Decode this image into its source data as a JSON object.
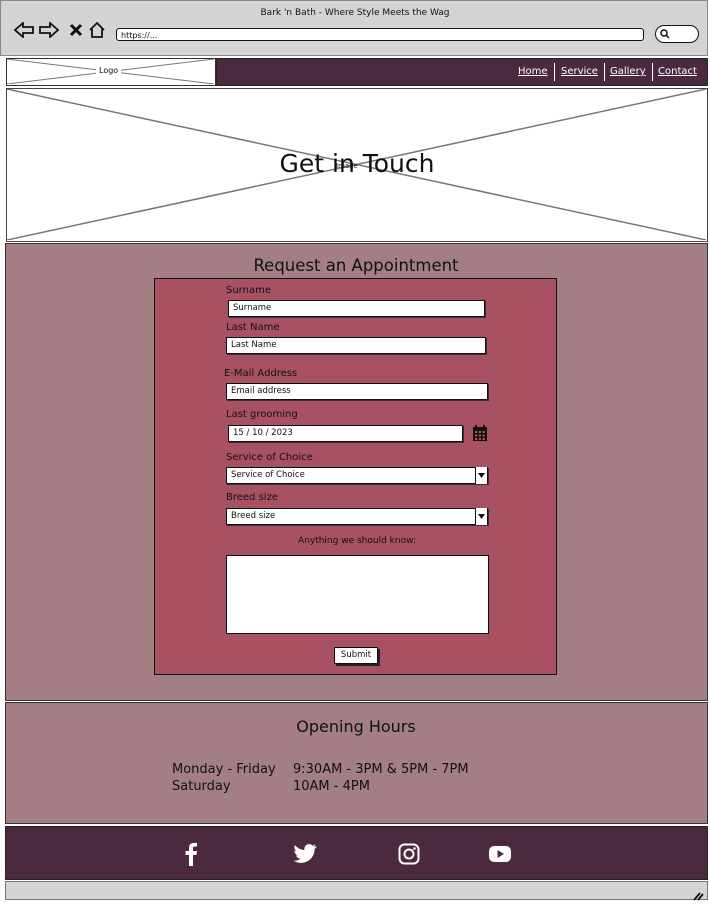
{
  "browser": {
    "title": "Bark 'n Bath - Where Style Meets the Wag",
    "url": "https://..."
  },
  "header": {
    "logo_label": "Logo",
    "nav": [
      "Home",
      "Service",
      "Gallery",
      "Contact"
    ]
  },
  "hero": {
    "title": "Get in Touch",
    "image_label": "Image"
  },
  "form": {
    "heading": "Request an Appointment",
    "surname_label": "Surname",
    "surname_placeholder": "Surname",
    "lastname_label": "Last Name",
    "lastname_placeholder": "Last Name",
    "email_label": "E-Mail Address",
    "email_placeholder": "Email address",
    "grooming_label": "Last grooming",
    "grooming_value": "15 / 10 / 2023",
    "service_label": "Service of Choice",
    "service_value": "Service of Choice",
    "breed_label": "Breed size",
    "breed_value": "Breed size",
    "notes_label": "Anything we should know:",
    "submit_label": "Submit"
  },
  "hours": {
    "title": "Opening Hours",
    "rows": [
      {
        "day": "Monday - Friday",
        "time": "9:30AM - 3PM & 5PM - 7PM"
      },
      {
        "day": "Saturday",
        "time": "10AM - 4PM"
      }
    ]
  },
  "footer": {
    "social_icons": [
      "facebook-icon",
      "twitter-icon",
      "instagram-icon",
      "youtube-icon"
    ]
  },
  "colors": {
    "nav_bg": "#4b2a3f",
    "section_bg": "#a37e84",
    "form_bg": "#a75163"
  }
}
